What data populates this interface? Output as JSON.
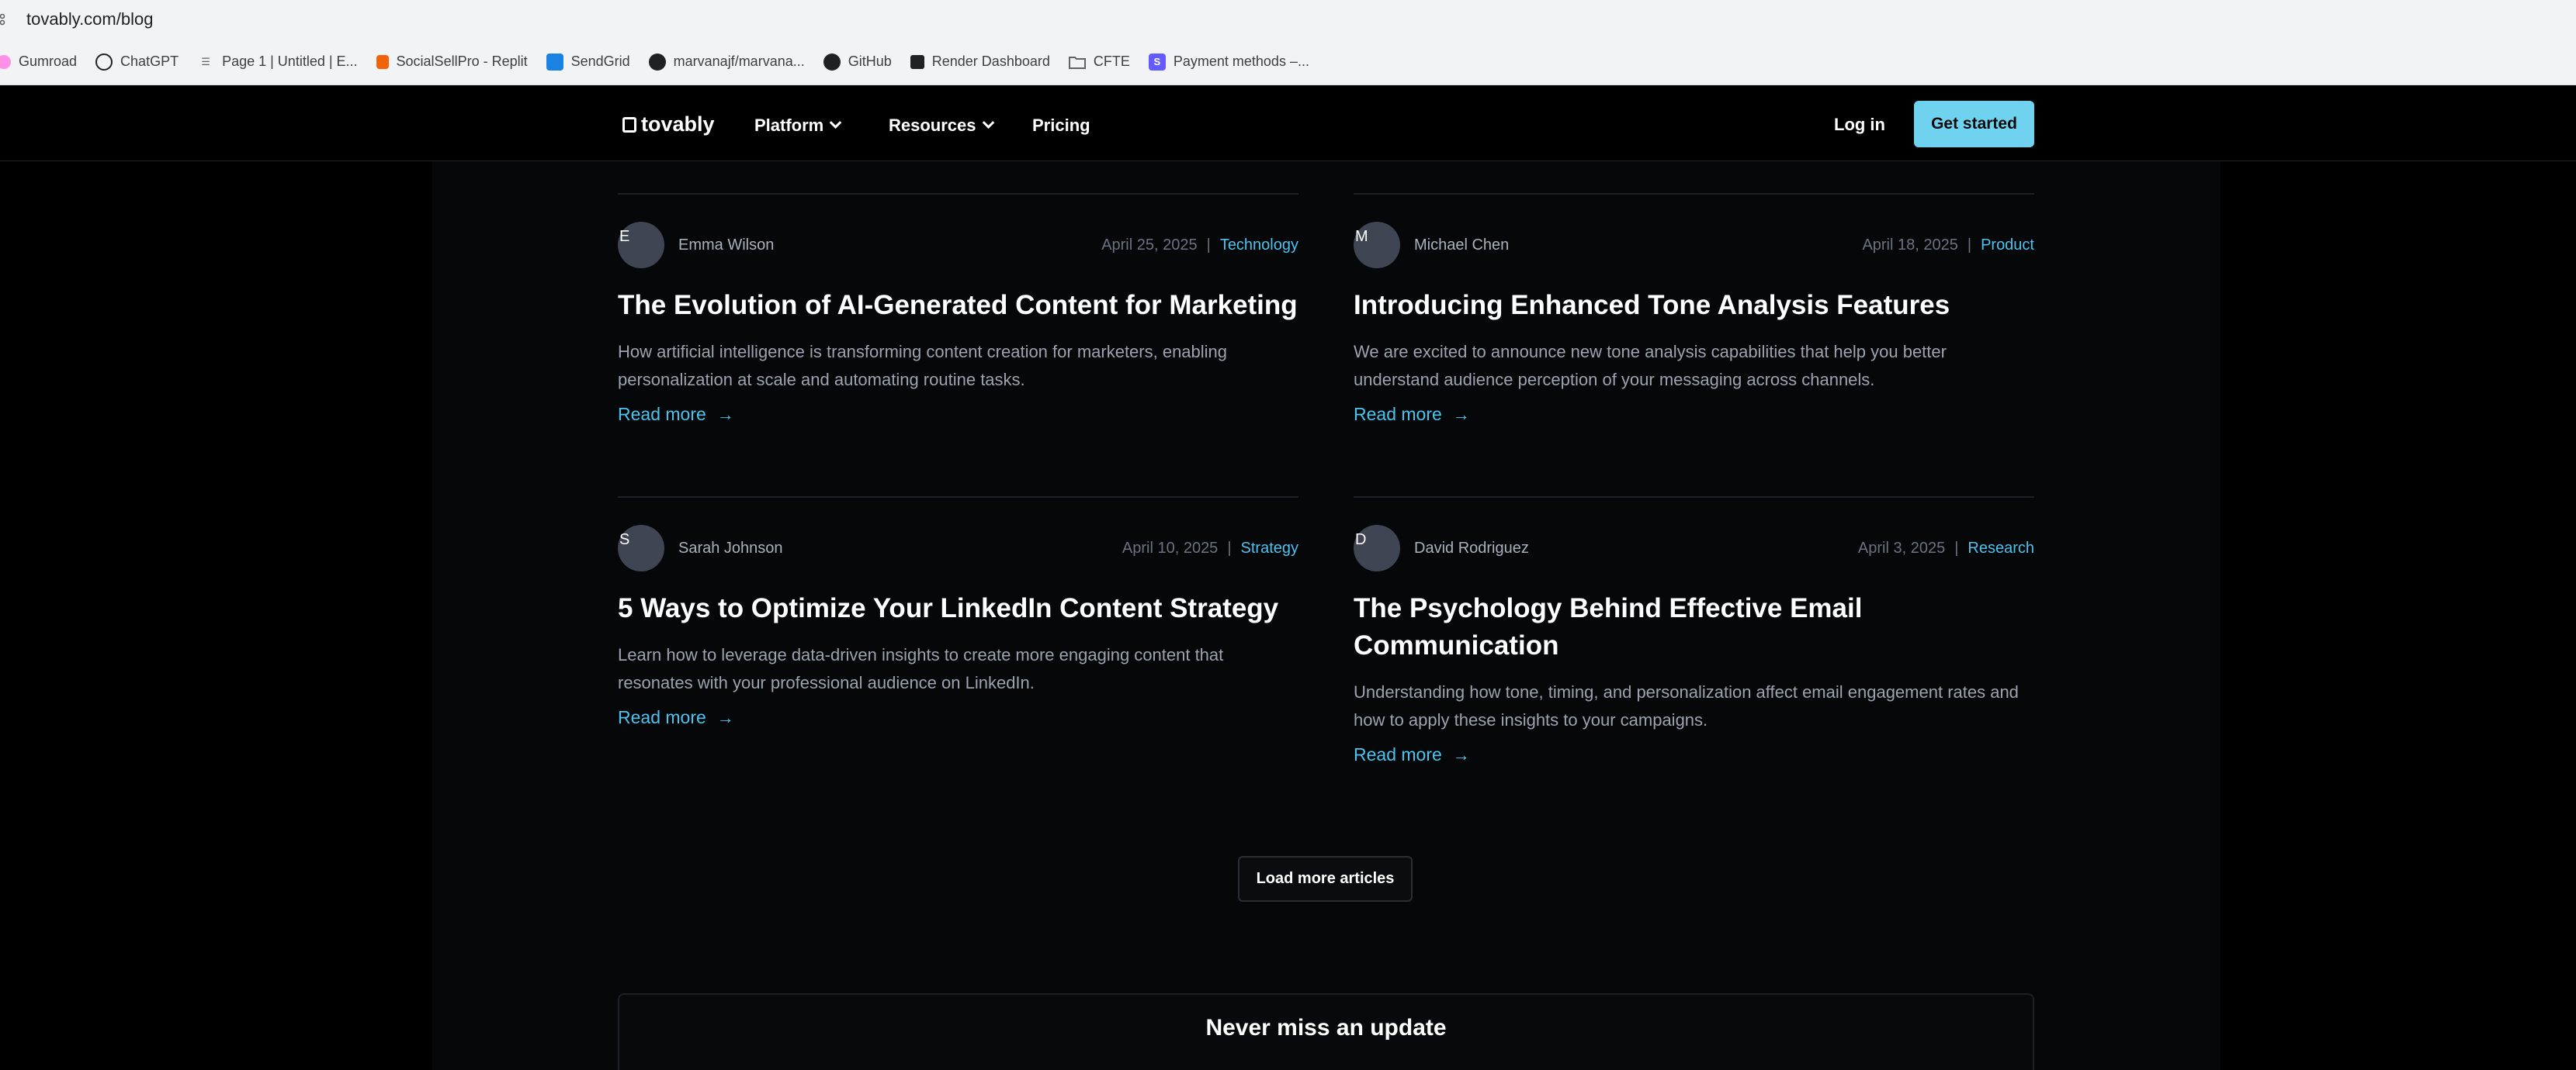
{
  "browser": {
    "url": "tovably.com/blog",
    "bookmarks": [
      {
        "label": "Gumroad",
        "icon": "gumroad-icon"
      },
      {
        "label": "ChatGPT",
        "icon": "chatgpt-icon"
      },
      {
        "label": "Page 1 | Untitled | E...",
        "icon": "page-icon"
      },
      {
        "label": "SocialSellPro - Replit",
        "icon": "replit-icon"
      },
      {
        "label": "SendGrid",
        "icon": "sendgrid-icon"
      },
      {
        "label": "marvanajf/marvana...",
        "icon": "github-icon"
      },
      {
        "label": "GitHub",
        "icon": "github-icon"
      },
      {
        "label": "Render Dashboard",
        "icon": "render-icon"
      },
      {
        "label": "CFTE",
        "icon": "folder-icon"
      },
      {
        "label": "Payment methods –...",
        "icon": "stripe-icon"
      }
    ]
  },
  "nav": {
    "logo": "tovably",
    "platform": "Platform",
    "resources": "Resources",
    "pricing": "Pricing",
    "login": "Log in",
    "cta": "Get started"
  },
  "articles": [
    {
      "initial": "E",
      "author": "Emma Wilson",
      "date": "April 25, 2025",
      "category": "Technology",
      "title": "The Evolution of AI-Generated Content for Marketing",
      "excerpt": "How artificial intelligence is transforming content creation for marketers, enabling personalization at scale and automating routine tasks.",
      "read_more": "Read more"
    },
    {
      "initial": "M",
      "author": "Michael Chen",
      "date": "April 18, 2025",
      "category": "Product",
      "title": "Introducing Enhanced Tone Analysis Features",
      "excerpt": "We are excited to announce new tone analysis capabilities that help you better understand audience perception of your messaging across channels.",
      "read_more": "Read more"
    },
    {
      "initial": "S",
      "author": "Sarah Johnson",
      "date": "April 10, 2025",
      "category": "Strategy",
      "title": "5 Ways to Optimize Your LinkedIn Content Strategy",
      "excerpt": "Learn how to leverage data-driven insights to create more engaging content that resonates with your professional audience on LinkedIn.",
      "read_more": "Read more"
    },
    {
      "initial": "D",
      "author": "David Rodriguez",
      "date": "April 3, 2025",
      "category": "Research",
      "title": "The Psychology Behind Effective Email Communication",
      "excerpt": "Understanding how tone, timing, and personalization affect email engagement rates and how to apply these insights to your campaigns.",
      "read_more": "Read more"
    }
  ],
  "load_more": "Load more articles",
  "newsletter": {
    "title": "Never miss an update"
  },
  "colors": {
    "accent": "#4cc3ee",
    "cta": "#6fd3f0",
    "background": "#000000"
  }
}
